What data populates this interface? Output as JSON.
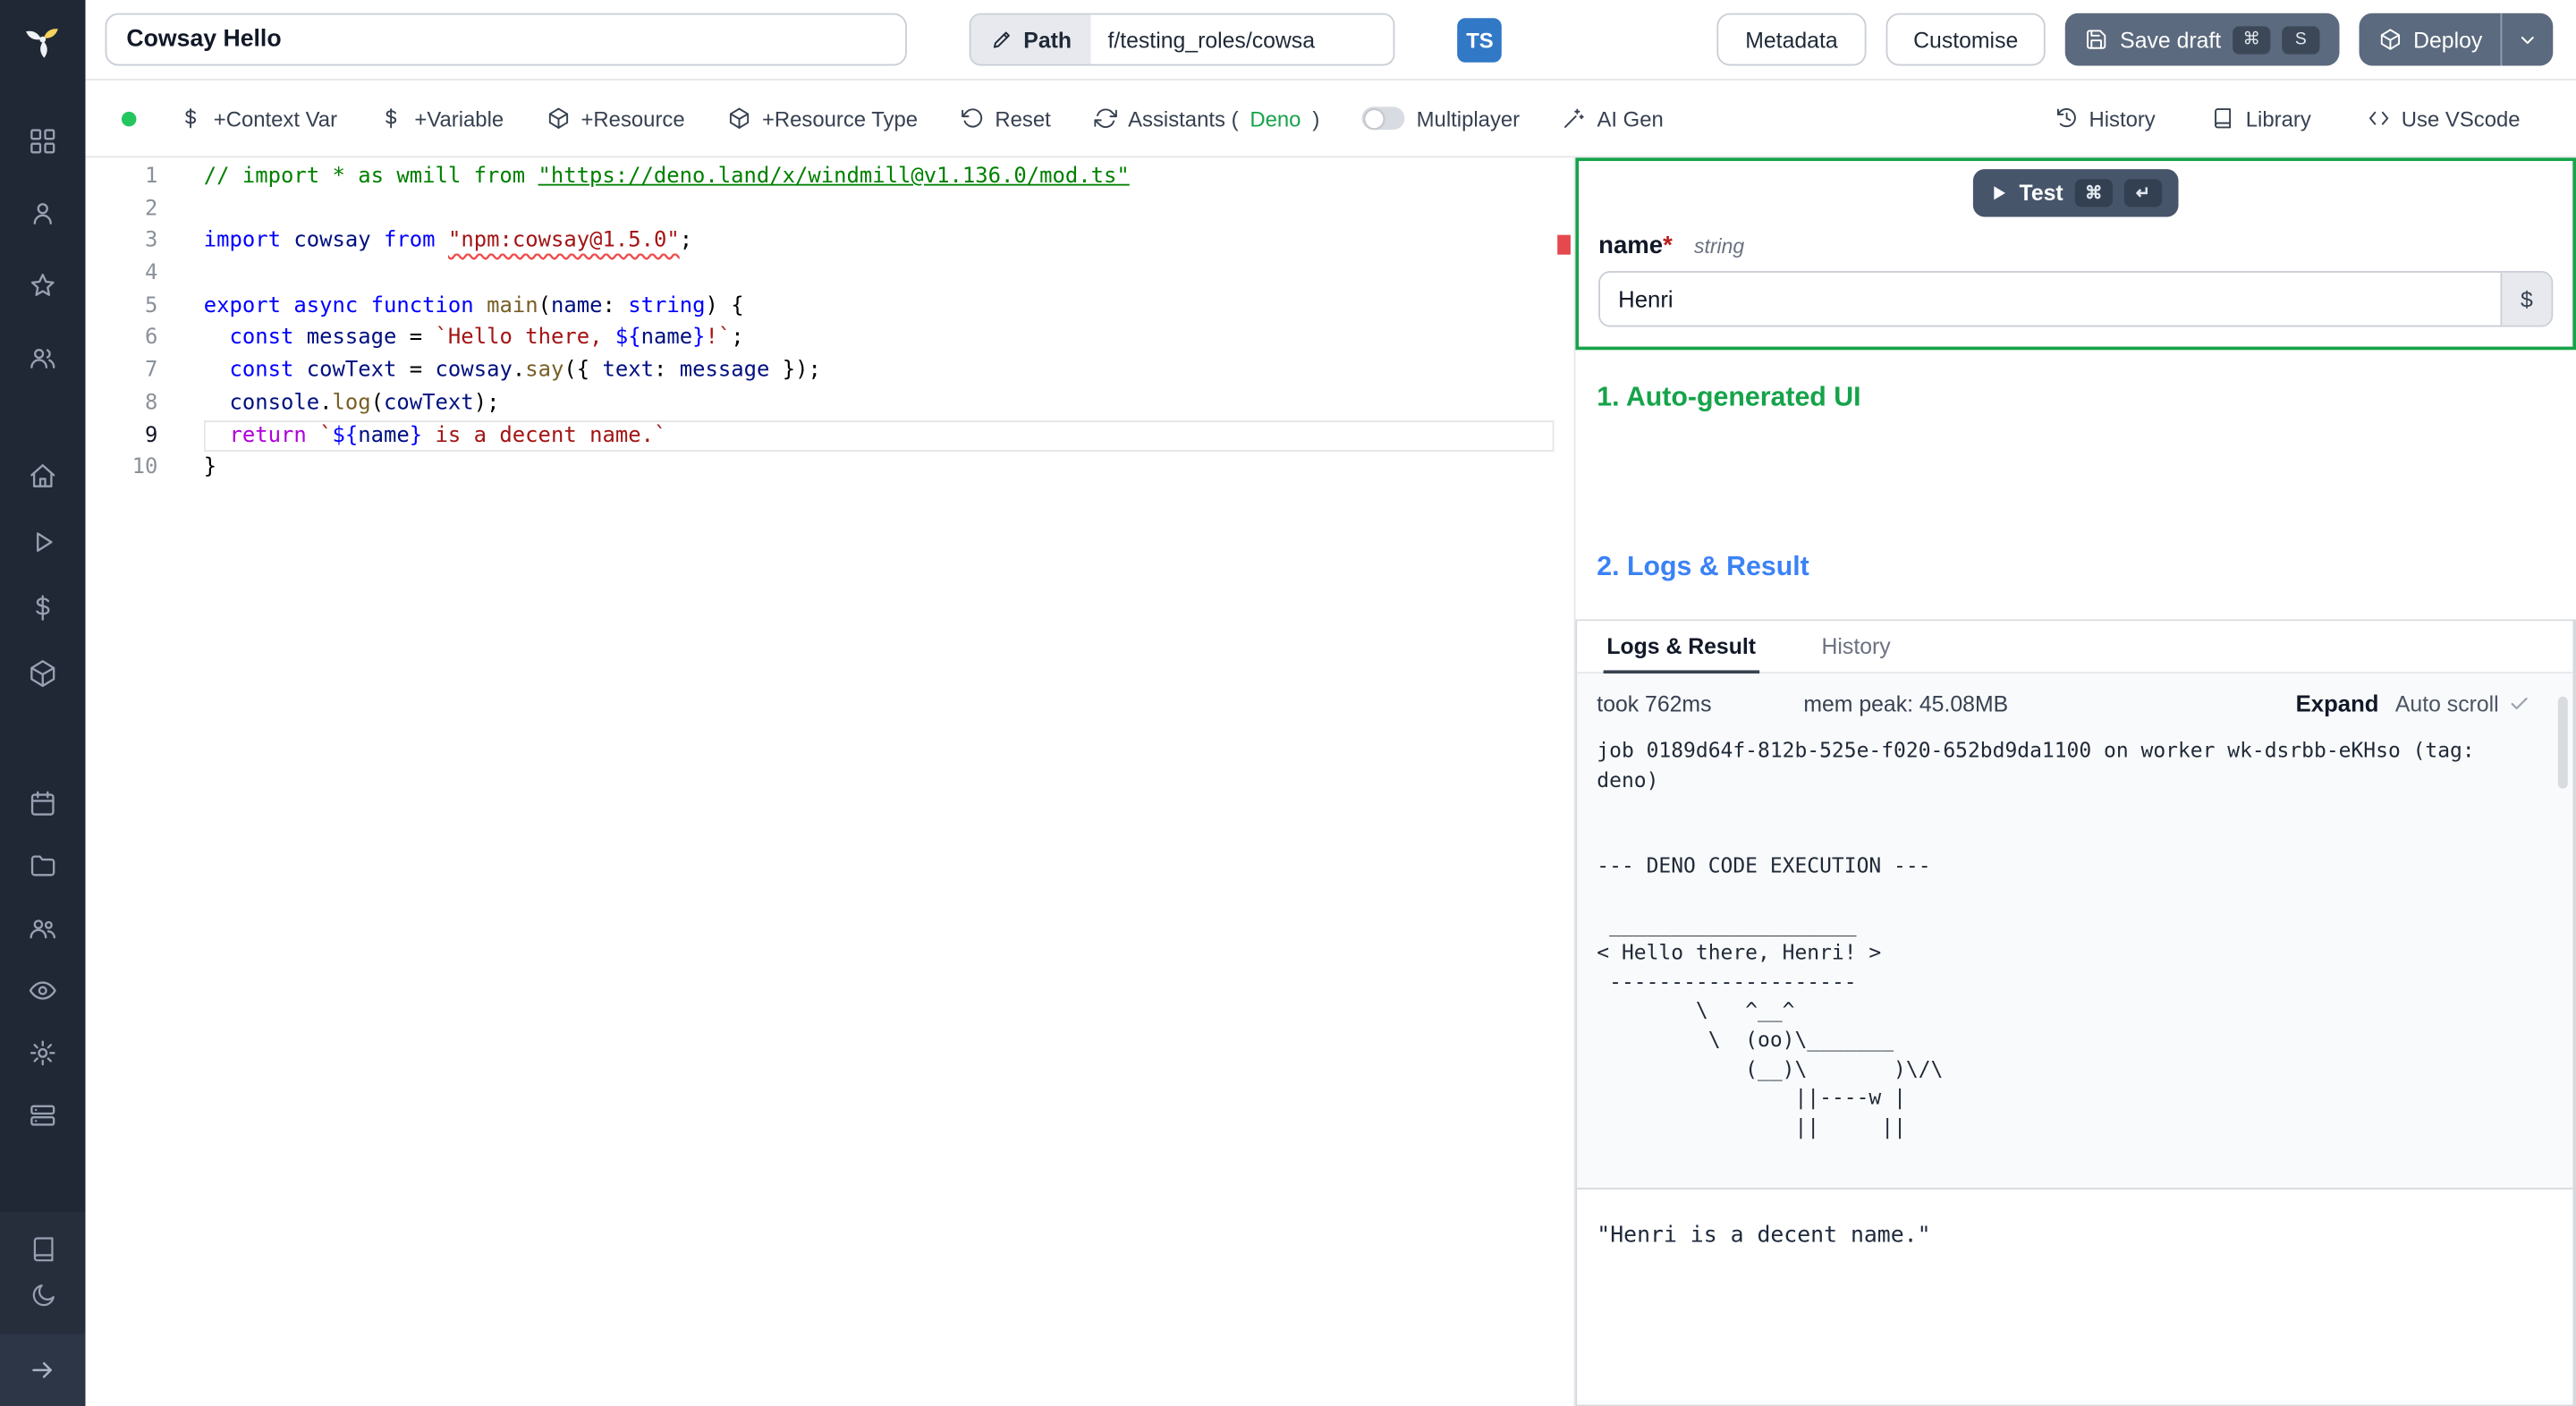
{
  "topbar": {
    "script_name": "Cowsay Hello",
    "path_label": "Path",
    "path_value": "f/testing_roles/cowsa",
    "language_badge": "TS",
    "metadata_label": "Metadata",
    "customise_label": "Customise",
    "save_draft_label": "Save draft",
    "save_kbd_mod": "⌘",
    "save_kbd_key": "S",
    "deploy_label": "Deploy"
  },
  "toolbar": {
    "context_var_label": "+Context Var",
    "variable_label": "+Variable",
    "resource_label": "+Resource",
    "resource_type_label": "+Resource Type",
    "reset_label": "Reset",
    "assistants_label": "Assistants (",
    "assistants_lang": "Deno",
    "assistants_close": ")",
    "multiplayer_label": "Multiplayer",
    "ai_gen_label": "AI Gen",
    "history_label": "History",
    "library_label": "Library",
    "vscode_label": "Use VScode"
  },
  "editor": {
    "lines": [
      {
        "n": "1",
        "tokens": [
          {
            "t": "// import * as wmill from ",
            "c": "cmt"
          },
          {
            "t": "\"https://deno.land/x/windmill@v1.136.0/mod.ts\"",
            "c": "cmtlink"
          }
        ]
      },
      {
        "n": "2",
        "tokens": []
      },
      {
        "n": "3",
        "tokens": [
          {
            "t": "import",
            "c": "kw"
          },
          {
            "t": " ",
            "c": "plain"
          },
          {
            "t": "cowsay",
            "c": "var"
          },
          {
            "t": " ",
            "c": "plain"
          },
          {
            "t": "from",
            "c": "kw"
          },
          {
            "t": " ",
            "c": "plain"
          },
          {
            "t": "\"npm:cowsay@1.5.0\"",
            "c": "strerr"
          },
          {
            "t": ";",
            "c": "plain"
          }
        ]
      },
      {
        "n": "4",
        "tokens": []
      },
      {
        "n": "5",
        "tokens": [
          {
            "t": "export",
            "c": "kw"
          },
          {
            "t": " ",
            "c": "plain"
          },
          {
            "t": "async",
            "c": "kw"
          },
          {
            "t": " ",
            "c": "plain"
          },
          {
            "t": "function",
            "c": "kw"
          },
          {
            "t": " ",
            "c": "plain"
          },
          {
            "t": "main",
            "c": "fn"
          },
          {
            "t": "(",
            "c": "plain"
          },
          {
            "t": "name",
            "c": "var"
          },
          {
            "t": ": ",
            "c": "plain"
          },
          {
            "t": "string",
            "c": "kw"
          },
          {
            "t": ") {",
            "c": "plain"
          }
        ]
      },
      {
        "n": "6",
        "tokens": [
          {
            "t": "  ",
            "c": "plain"
          },
          {
            "t": "const",
            "c": "kw"
          },
          {
            "t": " ",
            "c": "plain"
          },
          {
            "t": "message",
            "c": "var"
          },
          {
            "t": " = ",
            "c": "plain"
          },
          {
            "t": "`Hello there, ",
            "c": "str"
          },
          {
            "t": "${",
            "c": "kw"
          },
          {
            "t": "name",
            "c": "var"
          },
          {
            "t": "}",
            "c": "kw"
          },
          {
            "t": "!`",
            "c": "str"
          },
          {
            "t": ";",
            "c": "plain"
          }
        ]
      },
      {
        "n": "7",
        "tokens": [
          {
            "t": "  ",
            "c": "plain"
          },
          {
            "t": "const",
            "c": "kw"
          },
          {
            "t": " ",
            "c": "plain"
          },
          {
            "t": "cowText",
            "c": "var"
          },
          {
            "t": " = ",
            "c": "plain"
          },
          {
            "t": "cowsay",
            "c": "var"
          },
          {
            "t": ".",
            "c": "plain"
          },
          {
            "t": "say",
            "c": "fn"
          },
          {
            "t": "({ ",
            "c": "plain"
          },
          {
            "t": "text",
            "c": "var"
          },
          {
            "t": ": ",
            "c": "plain"
          },
          {
            "t": "message",
            "c": "var"
          },
          {
            "t": " });",
            "c": "plain"
          }
        ]
      },
      {
        "n": "8",
        "tokens": [
          {
            "t": "  ",
            "c": "plain"
          },
          {
            "t": "console",
            "c": "var"
          },
          {
            "t": ".",
            "c": "plain"
          },
          {
            "t": "log",
            "c": "fn"
          },
          {
            "t": "(",
            "c": "plain"
          },
          {
            "t": "cowText",
            "c": "var"
          },
          {
            "t": ");",
            "c": "plain"
          }
        ]
      },
      {
        "n": "9",
        "cur": true,
        "tokens": [
          {
            "t": "  ",
            "c": "plain"
          },
          {
            "t": "return",
            "c": "ctl"
          },
          {
            "t": " ",
            "c": "plain"
          },
          {
            "t": "`",
            "c": "str"
          },
          {
            "t": "${",
            "c": "kw"
          },
          {
            "t": "name",
            "c": "var"
          },
          {
            "t": "}",
            "c": "kw"
          },
          {
            "t": " is a decent name.`",
            "c": "str"
          }
        ]
      },
      {
        "n": "10",
        "tokens": [
          {
            "t": "}",
            "c": "plain"
          }
        ]
      }
    ]
  },
  "test_panel": {
    "test_label": "Test",
    "kbd_mod": "⌘",
    "kbd_enter": "↵",
    "field_name": "name",
    "required_mark": "*",
    "field_type": "string",
    "field_value": "Henri",
    "dollar_button": "$"
  },
  "sections": {
    "auto_ui": "1. Auto-generated UI",
    "logs_result": "2. Logs & Result"
  },
  "logs": {
    "tab_logs": "Logs & Result",
    "tab_history": "History",
    "took": "took 762ms",
    "mem_peak": "mem peak: 45.08MB",
    "expand_label": "Expand",
    "autoscroll_label": "Auto scroll",
    "content": "job 0189d64f-812b-525e-f020-652bd9da1100 on worker wk-dsrbb-eKHso (tag: deno)\n\n\n--- DENO CODE EXECUTION ---\n\n ____________________\n< Hello there, Henri! >\n --------------------\n        \\   ^__^\n         \\  (oo)\\_______\n            (__)\\       )\\/\\\n                ||----w |\n                ||     ||",
    "result": "\"Henri is a decent name.\""
  },
  "icons": [
    "windmill-logo",
    "grid-icon",
    "user-icon",
    "star-icon",
    "users-icon",
    "home-icon",
    "play-icon",
    "dollar-icon",
    "cube-icon",
    "calendar-icon",
    "folder-icon",
    "group-icon",
    "eye-icon",
    "gear-icon",
    "workers-icon",
    "book-icon",
    "moon-icon",
    "expand-arrow-icon",
    "pencil-icon",
    "floppy-icon",
    "package-icon",
    "chevron-down-icon",
    "dollar-sign-icon",
    "rotate-ccw-icon",
    "refresh-icon",
    "wand-icon",
    "clock-history-icon",
    "library-book-icon",
    "code-brackets-icon",
    "play-triangle-icon",
    "check-icon"
  ],
  "colors": {
    "accent_green": "#16a34a",
    "accent_blue": "#3b82f6",
    "ts_badge": "#3178c6",
    "error_red": "#e5484d",
    "sidebar_bg": "#212835"
  }
}
